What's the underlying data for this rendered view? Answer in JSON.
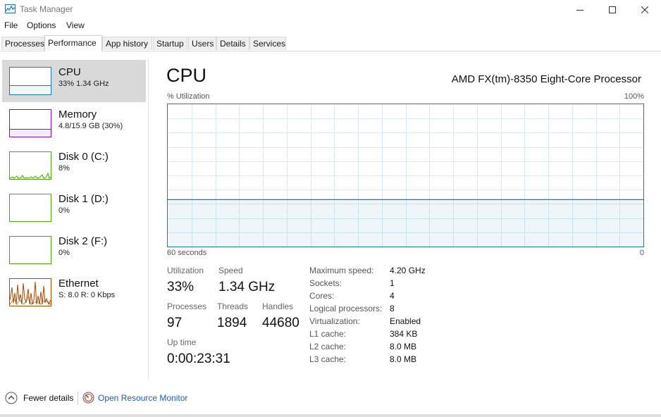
{
  "window": {
    "title": "Task Manager",
    "icon": "task-manager-icon"
  },
  "menu": [
    "File",
    "Options",
    "View"
  ],
  "tabs": [
    "Processes",
    "Performance",
    "App history",
    "Startup",
    "Users",
    "Details",
    "Services"
  ],
  "active_tab": "Performance",
  "sidebar": [
    {
      "title": "CPU",
      "subtitle": "33%  1.34 GHz",
      "color": "#1c7ab2",
      "fill_fraction": 0.33
    },
    {
      "title": "Memory",
      "subtitle": "4.8/15.9 GB (30%)",
      "color": "#8b12ae",
      "fill_fraction": 0.3
    },
    {
      "title": "Disk 0 (C:)",
      "subtitle": "8%",
      "color": "#4da60c"
    },
    {
      "title": "Disk 1 (D:)",
      "subtitle": "0%",
      "color": "#4da60c"
    },
    {
      "title": "Disk 2 (F:)",
      "subtitle": "0%",
      "color": "#4da60c"
    },
    {
      "title": "Ethernet",
      "subtitle": "S: 8.0  R: 0 Kbps",
      "color": "#a74f01"
    }
  ],
  "main": {
    "title": "CPU",
    "processor": "AMD FX(tm)-8350 Eight-Core Processor",
    "graph": {
      "y_label": "% Utilization",
      "y_max_label": "100%",
      "x_left_label": "60 seconds",
      "x_right_label": "0",
      "utilization_fraction": 0.33,
      "color": "#1c7ab2"
    },
    "stats": {
      "utilization_label": "Utilization",
      "utilization": "33%",
      "speed_label": "Speed",
      "speed": "1.34 GHz",
      "processes_label": "Processes",
      "processes": "97",
      "threads_label": "Threads",
      "threads": "1894",
      "handles_label": "Handles",
      "handles": "44680",
      "uptime_label": "Up time",
      "uptime": "0:00:23:31"
    },
    "specs": [
      {
        "label": "Maximum speed:",
        "value": "4.20 GHz"
      },
      {
        "label": "Sockets:",
        "value": "1"
      },
      {
        "label": "Cores:",
        "value": "4"
      },
      {
        "label": "Logical processors:",
        "value": "8"
      },
      {
        "label": "Virtualization:",
        "value": "Enabled"
      },
      {
        "label": "L1 cache:",
        "value": "384 KB"
      },
      {
        "label": "L2 cache:",
        "value": "8.0 MB"
      },
      {
        "label": "L3 cache:",
        "value": "8.0 MB"
      }
    ]
  },
  "footer": {
    "fewer_details": "Fewer details",
    "open_resource_monitor": "Open Resource Monitor"
  }
}
